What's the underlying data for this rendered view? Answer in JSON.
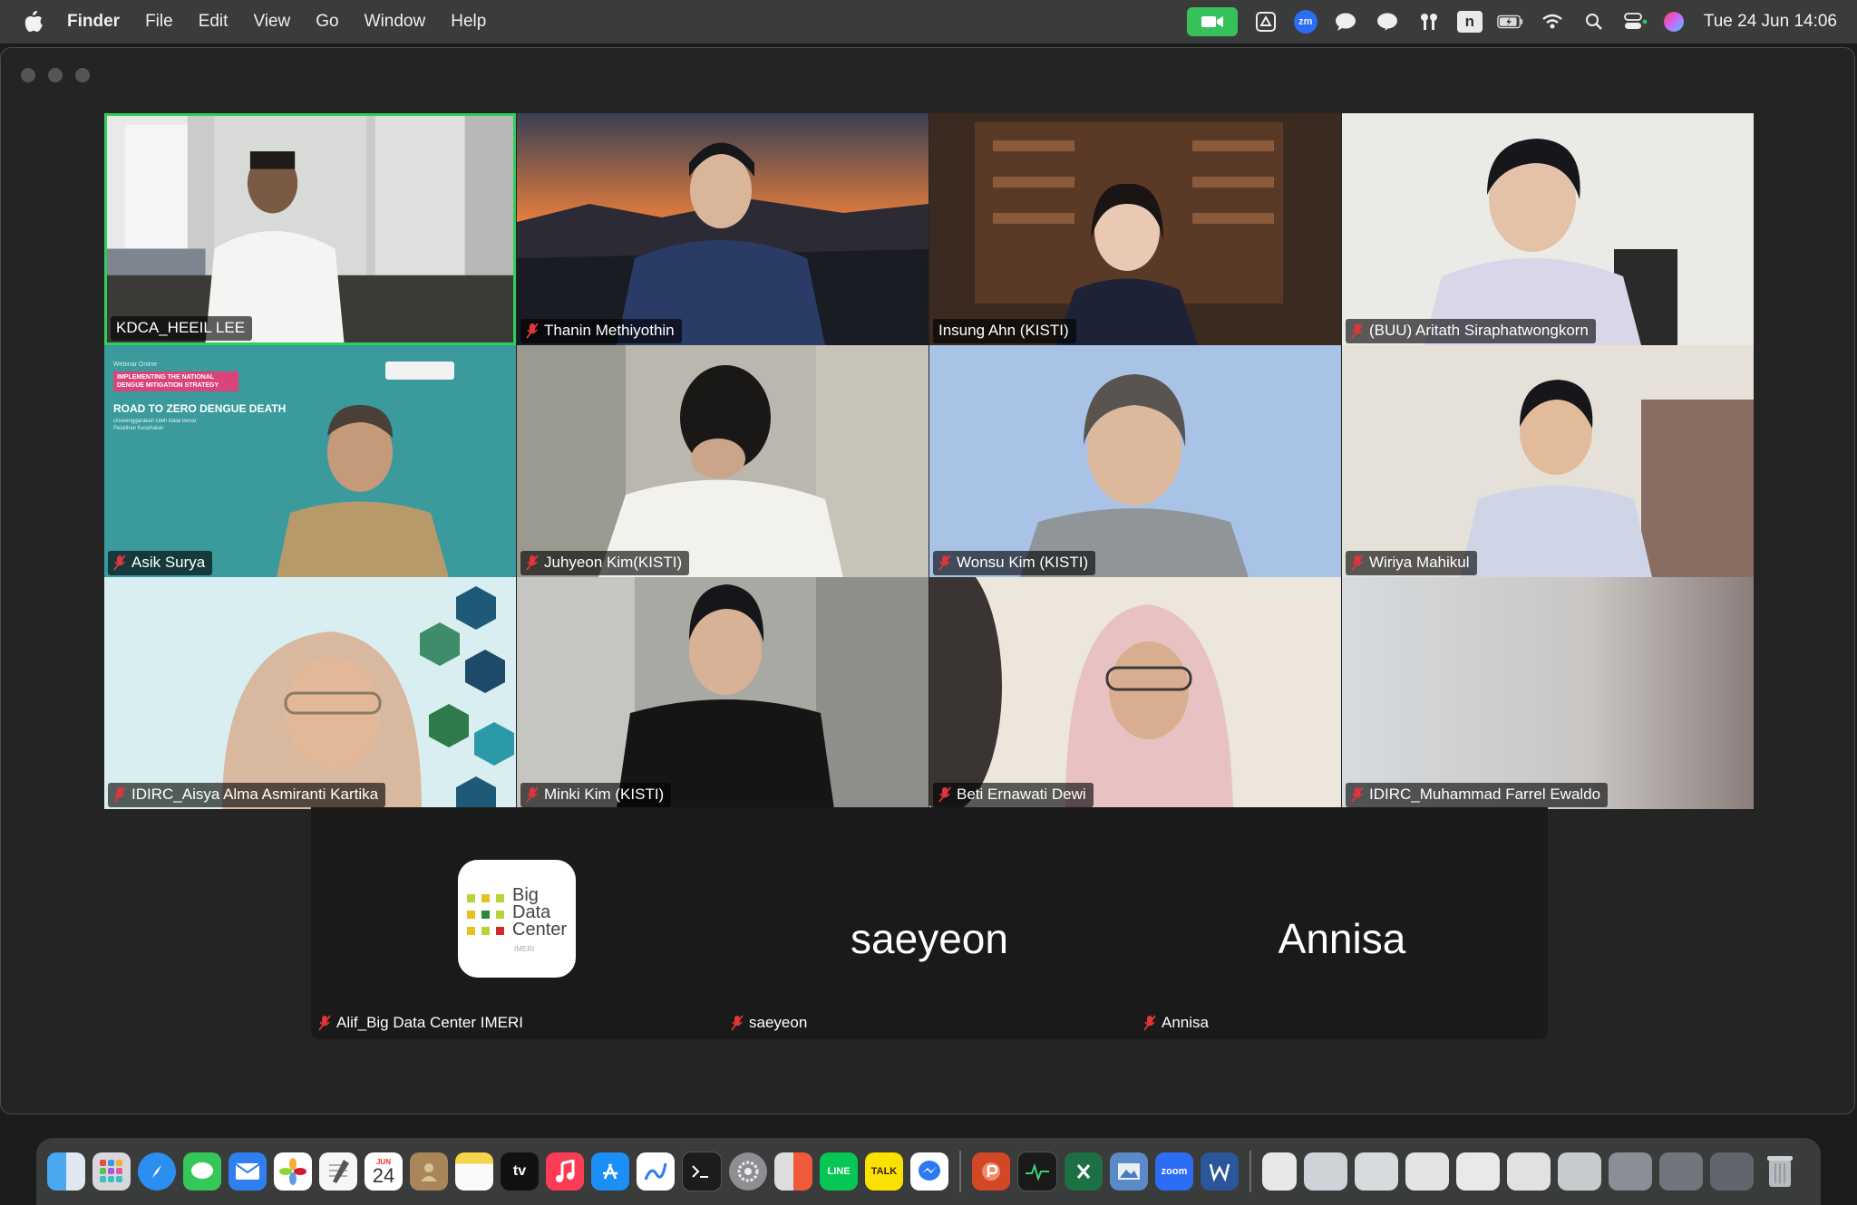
{
  "menubar": {
    "menus": [
      "Finder",
      "File",
      "Edit",
      "View",
      "Go",
      "Window",
      "Help"
    ],
    "clock": "Tue 24 Jun  14:06",
    "tray_icons": [
      "zoom-video-icon",
      "drive-icon",
      "zoom-icon",
      "messages-icon",
      "line-icon",
      "airpods-icon",
      "n-app-icon",
      "battery-icon",
      "wifi-icon",
      "spotlight-icon",
      "control-center-icon",
      "siri-icon"
    ],
    "zm_label": "zm",
    "n_label": "n"
  },
  "meeting": {
    "participants": [
      {
        "name": "KDCA_HEEIL LEE",
        "muted": false,
        "active_speaker": true
      },
      {
        "name": "Thanin Methiyothin",
        "muted": true
      },
      {
        "name": "Insung Ahn (KISTI)",
        "muted": false
      },
      {
        "name": "(BUU) Aritath Siraphatwongkorn",
        "muted": true
      },
      {
        "name": "Asik Surya",
        "muted": true
      },
      {
        "name": "Juhyeon Kim(KISTI)",
        "muted": true
      },
      {
        "name": "Wonsu Kim (KISTI)",
        "muted": true
      },
      {
        "name": "Wiriya Mahikul",
        "muted": true
      },
      {
        "name": "IDIRC_Aisya Alma Asmiranti Kartika",
        "muted": true
      },
      {
        "name": "Minki Kim (KISTI)",
        "muted": true
      },
      {
        "name": "Beti Ernawati Dewi",
        "muted": true
      },
      {
        "name": "IDIRC_Muhammad Farrel Ewaldo",
        "muted": true
      }
    ],
    "slide_text": {
      "kicker": "Webinar Online",
      "banner": "IMPLEMENTING THE NATIONAL DENGUE MITIGATION STRATEGY",
      "title": "ROAD TO ZERO DENGUE DEATH",
      "subtitle": "Diselenggarakan Oleh Balai Besar Pelatihan Kesehatan"
    },
    "audio_only": [
      {
        "name": "Alif_Big Data Center IMERI",
        "display": "",
        "logo": {
          "line1": "Big",
          "line2": "Data",
          "line3": "Center",
          "line4": "IMERI"
        }
      },
      {
        "name": "saeyeon",
        "display": "saeyeon"
      },
      {
        "name": "Annisa",
        "display": "Annisa"
      }
    ]
  },
  "dock": {
    "calendar_month": "JUN",
    "calendar_day": "24",
    "tv_label": "tv",
    "line_label": "LINE",
    "talk_label": "TALK",
    "zoom_label": "zoom",
    "items": [
      "finder-icon",
      "launchpad-icon",
      "safari-icon",
      "messages-icon",
      "mail-icon",
      "photos-icon",
      "textedit-icon",
      "calendar-icon",
      "contacts-icon",
      "notes-icon",
      "tv-icon",
      "music-icon",
      "appstore-icon",
      "freeform-icon",
      "terminal-icon",
      "system-settings-icon",
      "iphone-mirroring-icon",
      "line-icon",
      "kakaotalk-icon",
      "messenger-icon",
      "powerpoint-icon",
      "activity-monitor-icon",
      "excel-icon",
      "preview-icon",
      "zoom-icon",
      "word-icon",
      "document-1-icon",
      "document-2-icon",
      "document-3-icon",
      "document-4-icon",
      "document-5-icon",
      "document-6-icon",
      "document-7-icon",
      "document-8-icon",
      "document-9-icon",
      "document-10-icon",
      "trash-icon"
    ]
  }
}
